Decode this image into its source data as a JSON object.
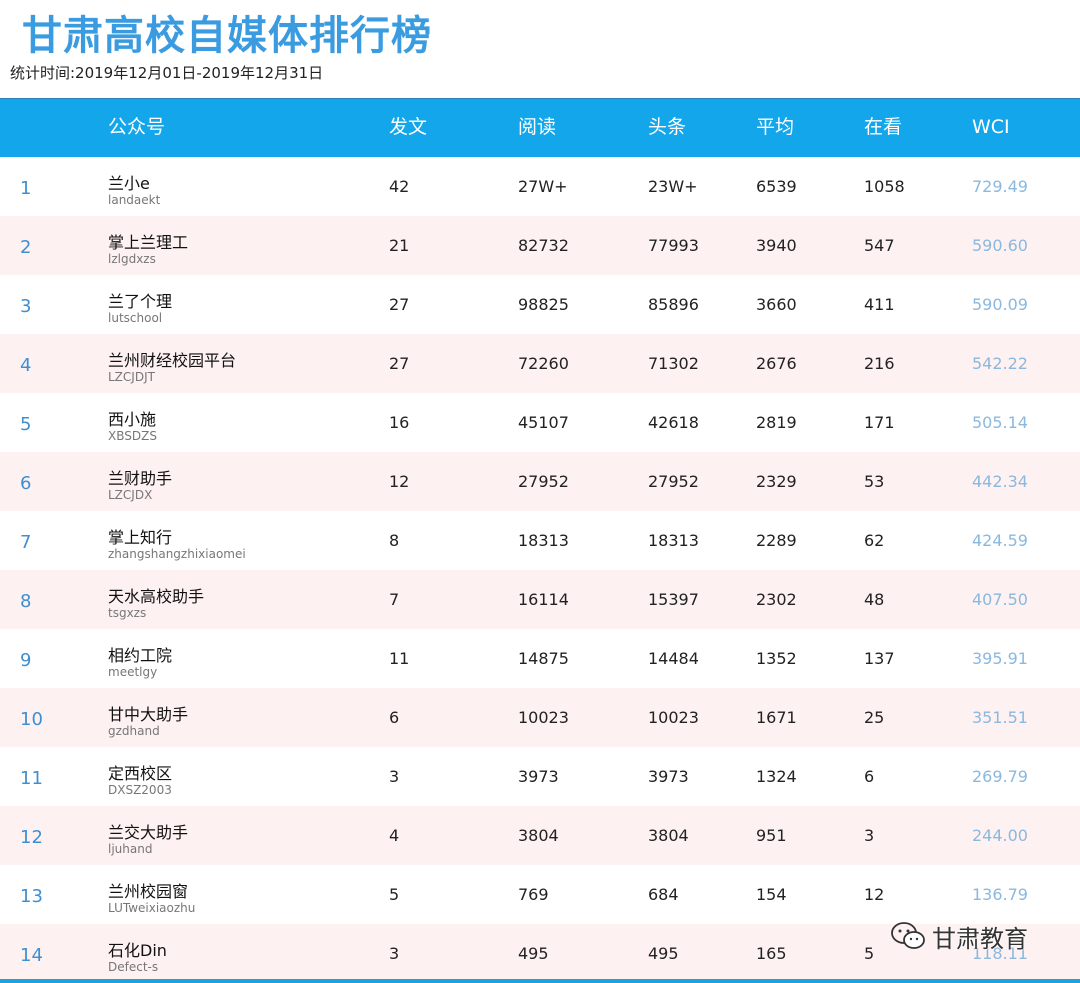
{
  "title": "甘肃高校自媒体排行榜",
  "subtitle": "统计时间:2019年12月01日-2019年12月31日",
  "columns": [
    "公众号",
    "发文",
    "阅读",
    "头条",
    "平均",
    "在看",
    "WCI"
  ],
  "rows": [
    {
      "rank": "1",
      "name": "兰小e",
      "account": "landaekt",
      "posts": "42",
      "reads": "27W+",
      "headline": "23W+",
      "avg": "6539",
      "watching": "1058",
      "wci": "729.49"
    },
    {
      "rank": "2",
      "name": "掌上兰理工",
      "account": "lzlgdxzs",
      "posts": "21",
      "reads": "82732",
      "headline": "77993",
      "avg": "3940",
      "watching": "547",
      "wci": "590.60"
    },
    {
      "rank": "3",
      "name": "兰了个理",
      "account": "lutschool",
      "posts": "27",
      "reads": "98825",
      "headline": "85896",
      "avg": "3660",
      "watching": "411",
      "wci": "590.09"
    },
    {
      "rank": "4",
      "name": "兰州财经校园平台",
      "account": "LZCJDJT",
      "posts": "27",
      "reads": "72260",
      "headline": "71302",
      "avg": "2676",
      "watching": "216",
      "wci": "542.22"
    },
    {
      "rank": "5",
      "name": "西小施",
      "account": "XBSDZS",
      "posts": "16",
      "reads": "45107",
      "headline": "42618",
      "avg": "2819",
      "watching": "171",
      "wci": "505.14"
    },
    {
      "rank": "6",
      "name": "兰财助手",
      "account": "LZCJDX",
      "posts": "12",
      "reads": "27952",
      "headline": "27952",
      "avg": "2329",
      "watching": "53",
      "wci": "442.34"
    },
    {
      "rank": "7",
      "name": "掌上知行",
      "account": "zhangshangzhixiaomei",
      "posts": "8",
      "reads": "18313",
      "headline": "18313",
      "avg": "2289",
      "watching": "62",
      "wci": "424.59"
    },
    {
      "rank": "8",
      "name": "天水高校助手",
      "account": "tsgxzs",
      "posts": "7",
      "reads": "16114",
      "headline": "15397",
      "avg": "2302",
      "watching": "48",
      "wci": "407.50"
    },
    {
      "rank": "9",
      "name": "相约工院",
      "account": "meetlgy",
      "posts": "11",
      "reads": "14875",
      "headline": "14484",
      "avg": "1352",
      "watching": "137",
      "wci": "395.91"
    },
    {
      "rank": "10",
      "name": "甘中大助手",
      "account": "gzdhand",
      "posts": "6",
      "reads": "10023",
      "headline": "10023",
      "avg": "1671",
      "watching": "25",
      "wci": "351.51"
    },
    {
      "rank": "11",
      "name": "定西校区",
      "account": "DXSZ2003",
      "posts": "3",
      "reads": "3973",
      "headline": "3973",
      "avg": "1324",
      "watching": "6",
      "wci": "269.79"
    },
    {
      "rank": "12",
      "name": "兰交大助手",
      "account": "ljuhand",
      "posts": "4",
      "reads": "3804",
      "headline": "3804",
      "avg": "951",
      "watching": "3",
      "wci": "244.00"
    },
    {
      "rank": "13",
      "name": "兰州校园窗",
      "account": "LUTweixiaozhu",
      "posts": "5",
      "reads": "769",
      "headline": "684",
      "avg": "154",
      "watching": "12",
      "wci": "136.79"
    },
    {
      "rank": "14",
      "name": "石化Din",
      "account": "Defect-s",
      "posts": "3",
      "reads": "495",
      "headline": "495",
      "avg": "165",
      "watching": "5",
      "wci": "118.11"
    }
  ],
  "watermark": {
    "icon": "wechat-icon",
    "text": "甘肃教育"
  }
}
